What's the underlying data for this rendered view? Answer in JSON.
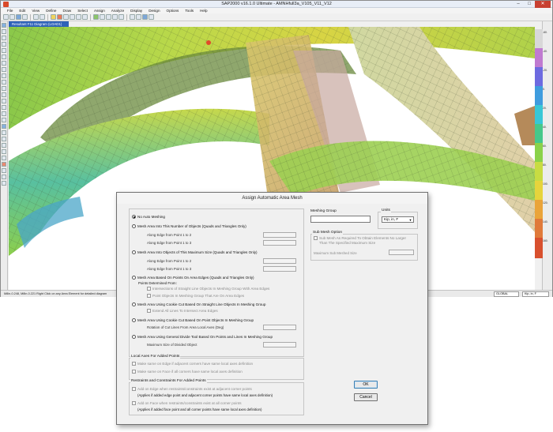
{
  "window": {
    "title": "SAP2000 v16.1.0 Ultimate  -  AMNHfull3a_V105_V11_V12",
    "minimize": "–",
    "maximize": "□",
    "close": "✕"
  },
  "menu": [
    "File",
    "Edit",
    "View",
    "Define",
    "Draw",
    "Select",
    "Assign",
    "Analyze",
    "Display",
    "Design",
    "Options",
    "Tools",
    "Help"
  ],
  "document_tab": "Resultant F11 Diagram   (LOAD1)",
  "legend": {
    "colors": [
      "#d8d8d8",
      "#c07ad0",
      "#6d6ae0",
      "#3f9cde",
      "#38c7d6",
      "#46c88a",
      "#8ad24a",
      "#c8dc42",
      "#e6d43c",
      "#eaa43a",
      "#e07a3a",
      "#d8502e"
    ],
    "labels": [
      "-60.",
      "-40.",
      "-20.",
      "0.",
      "20.",
      "40.",
      "60.",
      "80.",
      "100.",
      "120.",
      "140.",
      "160."
    ]
  },
  "statusbar": {
    "message": "M8in-0.248, M8in-0.221  Right Click on any Area Element for detailed diagram",
    "coord_system": "GLOBAL",
    "units": "Kip, in, F"
  },
  "dialog": {
    "title": "Assign Automatic Area Mesh",
    "no_auto_meshing": "No Auto Meshing",
    "opt_number": "Mesh Area Into This Number of Objects    (Quads and Triangles Only)",
    "opt_number_edge12": "Along Edge from Point 1 to 2",
    "opt_number_edge13": "Along Edge from Point 1 to 3",
    "opt_maxsize": "Mesh Area Into Objects of This Maximum Size    (Quads and Triangles Only)",
    "opt_maxsize_edge12": "Along Edge from Point 1 to 2",
    "opt_maxsize_edge13": "Along Edge from Point 1 to 3",
    "opt_points": "Mesh Area Based On Points On Area Edges     (Quads and Triangles Only)",
    "points_determined": "Points Determined From:",
    "points_intersections": "Intersections of Straight Line Objects In Meshing Group With Area Edges",
    "points_objects": "Point Objects In Meshing Group That Are On Area Edges",
    "opt_cookie_lines": "Mesh Area Using Cookie Cut Based On Straight Line Objects In Meshing Group",
    "extend_lines": "Extend All Lines To Intersect Area Edges",
    "opt_cookie_points": "Mesh Area Using Cookie Cut Based On Point Objects In Meshing Group",
    "rotation_label": "Rotation of Cut Lines From Area Local Axes (Deg)",
    "opt_general_divide": "Mesh Area Using General Divide Tool Based On  Points and Lines In Meshing Group",
    "max_divided": "Maximum Size of Divided Object",
    "meshing_group_label": "Meshing Group",
    "units_label": "Units",
    "units_value": "Kip, in, F",
    "submesh_label": "Sub Mesh Option",
    "submesh_check": "Sub Mesh As Required To Obtain Elements No Larger Than The Specified Maximum Size",
    "max_submeshed_size": "Maximum Sub Meshed Size",
    "local_axes_label": "Local Axes For Added Points",
    "local_edge": "Make same on Edge if adjacent corners have same local axes definition",
    "local_face": "Make same on Face if all corners have same local axes definition",
    "restraints_label": "Restraints and Constraints For Added Points",
    "restraint_edge_1": "Add on Edge when restraints/constraints exist at adjacent corner points",
    "restraint_edge_2": "(Applies if added edge point and adjacent corner points have same local axes definition)",
    "restraint_face_1": "Add on Face when restraints/constraints exist at all corner points",
    "restraint_face_2": "(Applies if added face point and all corner points have same local axes definition)",
    "ok": "OK",
    "cancel": "Cancel"
  }
}
